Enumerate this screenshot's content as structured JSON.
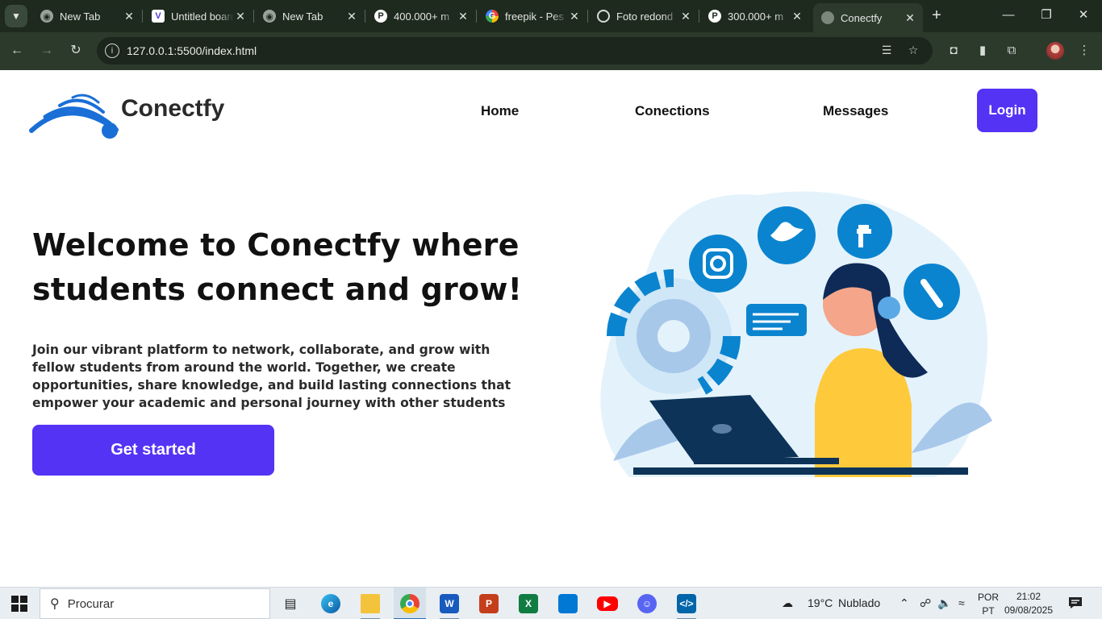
{
  "browser": {
    "tabs": [
      {
        "title": "New Tab",
        "favicon": "chrome-icon"
      },
      {
        "title": "Untitled board",
        "favicon": "vertabelo-icon"
      },
      {
        "title": "New Tab",
        "favicon": "chrome-icon"
      },
      {
        "title": "400.000+ m",
        "favicon": "pexels-icon"
      },
      {
        "title": "freepik - Pes",
        "favicon": "google-icon"
      },
      {
        "title": "Foto redond",
        "favicon": "openai-icon"
      },
      {
        "title": "300.000+ m",
        "favicon": "pexels-icon"
      },
      {
        "title": "Conectfy",
        "favicon": "globe-icon",
        "active": true
      }
    ],
    "url": "127.0.0.1:5500/index.html"
  },
  "site": {
    "brand": "Conectfy",
    "nav": {
      "home": "Home",
      "connections": "Conections",
      "messages": "Messages",
      "login": "Login"
    },
    "hero": {
      "title": "Welcome to Conectfy where students connect and grow!",
      "text": "Join our vibrant platform to network, collaborate, and grow with fellow students from around the world. Together, we create opportunities, share knowledge, and build lasting connections that empower your academic and personal journey with other students",
      "cta": "Get started"
    },
    "colors": {
      "accent": "#5433f5",
      "logo_blue": "#1a6fd6",
      "illustration_blue": "#0b84cf"
    }
  },
  "taskbar": {
    "search_placeholder": "Procurar",
    "apps": [
      "task-view-icon",
      "edge-icon",
      "file-explorer-icon",
      "chrome-icon",
      "word-icon",
      "powerpoint-icon",
      "excel-icon",
      "store-icon",
      "youtube-icon",
      "discord-icon",
      "vscode-icon"
    ],
    "weather": {
      "temp": "19°C",
      "condition": "Nublado"
    },
    "language": {
      "line1": "POR",
      "line2": "PT"
    },
    "clock": {
      "time": "21:02",
      "date": "09/08/2025"
    }
  }
}
